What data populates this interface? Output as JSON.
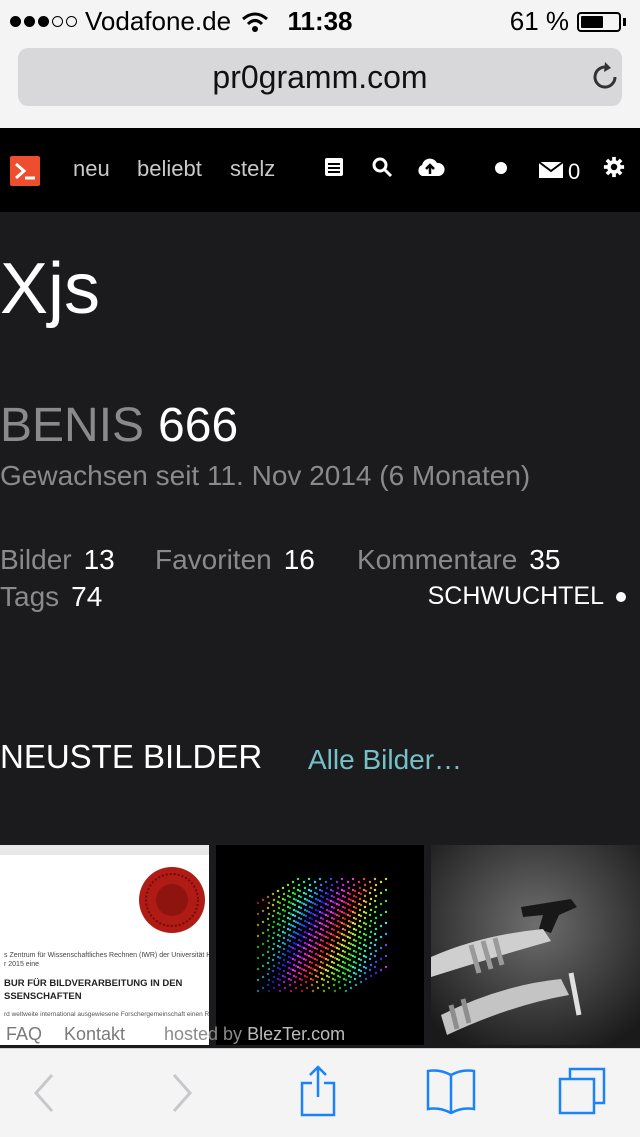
{
  "status_bar": {
    "carrier": "Vodafone.de",
    "time": "11:38",
    "battery": "61 %",
    "battery_level": 0.61
  },
  "browser": {
    "url": "pr0gramm.com"
  },
  "site_nav": {
    "links": [
      "neu",
      "beliebt",
      "stelz"
    ],
    "message_count": "0"
  },
  "profile": {
    "username": "Xjs",
    "benis_label": "BENIS",
    "benis_value": "666",
    "member_since": "Gewachsen seit 11. Nov 2014 (6 Monaten)",
    "stats": {
      "bilder_label": "Bilder",
      "bilder_value": "13",
      "favoriten_label": "Favoriten",
      "favoriten_value": "16",
      "kommentare_label": "Kommentare",
      "kommentare_value": "35",
      "tags_label": "Tags",
      "tags_value": "74"
    },
    "rank": "SCHWUCHTEL"
  },
  "latest": {
    "title": "NEUSTE BILDER",
    "all_link": "Alle Bilder…",
    "thumb1_lines": [
      "s Zentrum für Wissenschaftliches Rechnen (IWR) der Universität Heidelbe",
      "r 2015 eine",
      "BUR FÜR BILDVERARBEITUNG IN DEN",
      "SSENSCHAFTEN",
      "rd weltweite international ausgewiesene Forschergemeinschaft einen Re"
    ]
  },
  "footer": {
    "faq": "FAQ",
    "kontakt": "Kontakt",
    "hosted_by": "hosted by",
    "host": "BlezTer.com"
  },
  "colors": {
    "accent": "#ee4d2e",
    "link": "#75c0c7",
    "background": "#1b1b1d",
    "muted": "#8a8a8a",
    "ios_blue": "#1a82fb"
  }
}
